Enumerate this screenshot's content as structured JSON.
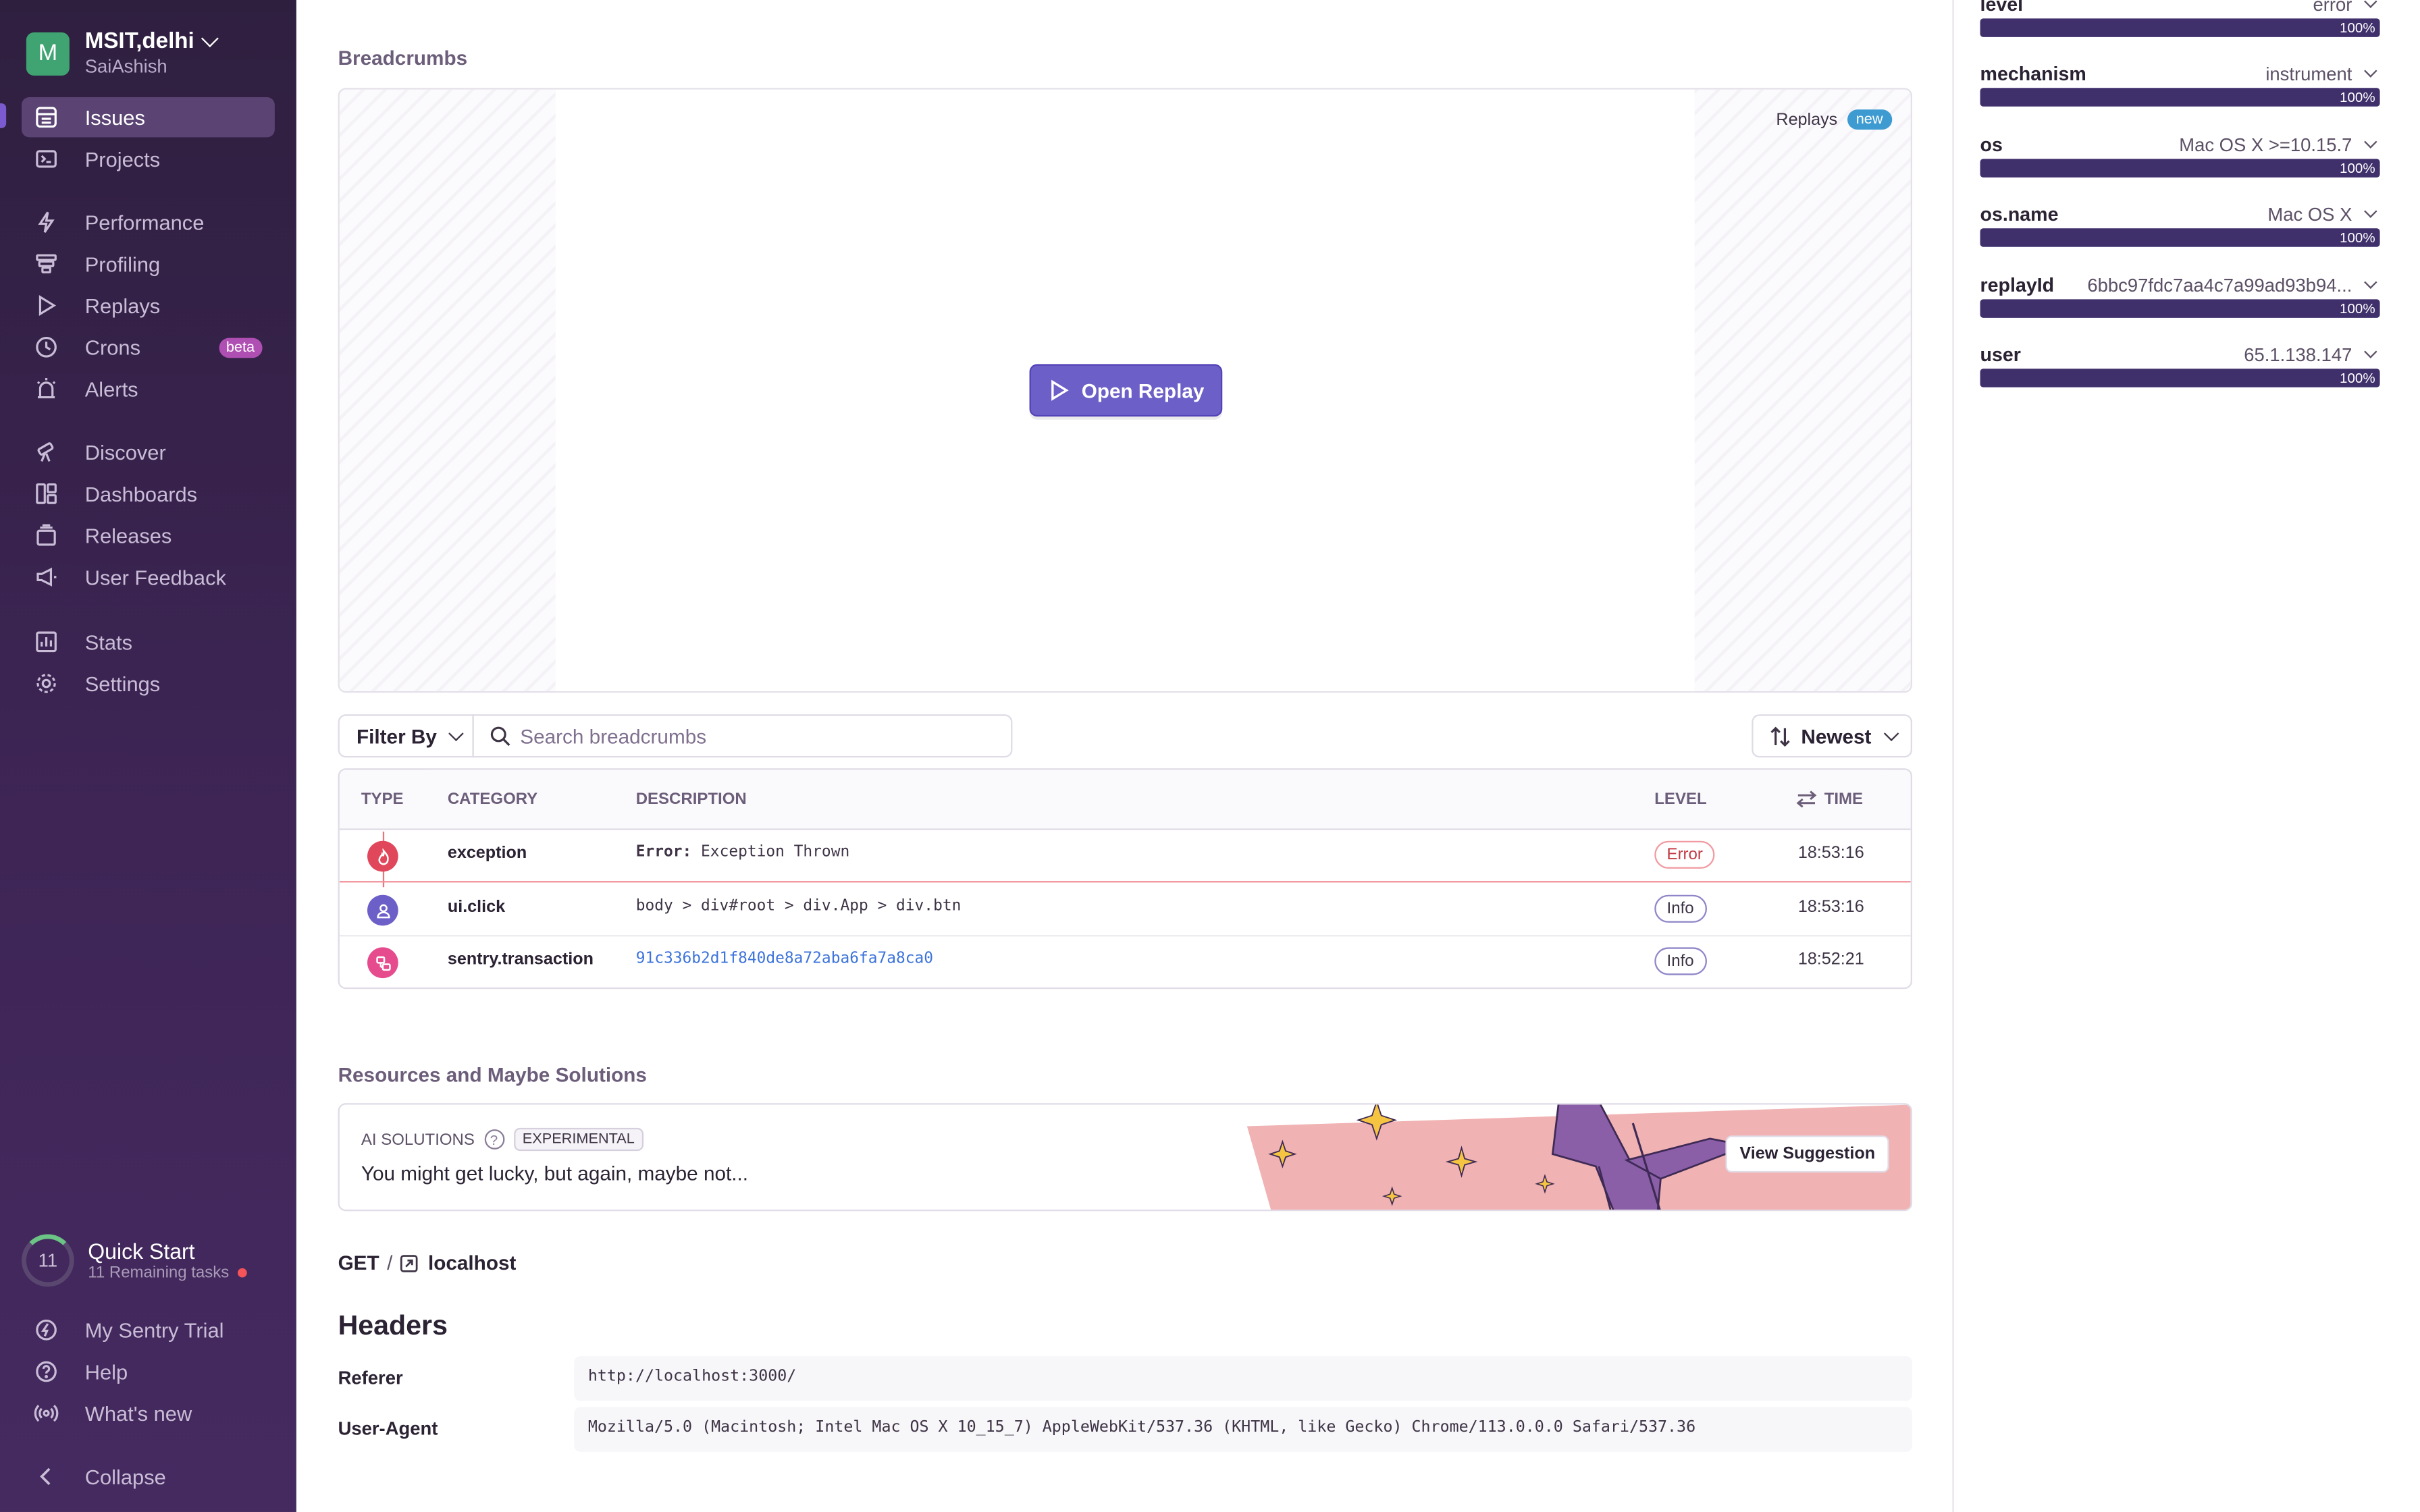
{
  "org": {
    "initial": "M",
    "name": "MSIT,delhi",
    "user": "SaiAshish"
  },
  "nav": {
    "issues": "Issues",
    "projects": "Projects",
    "performance": "Performance",
    "profiling": "Profiling",
    "replays": "Replays",
    "crons": "Crons",
    "crons_badge": "beta",
    "alerts": "Alerts",
    "discover": "Discover",
    "dashboards": "Dashboards",
    "releases": "Releases",
    "user_feedback": "User Feedback",
    "stats": "Stats",
    "settings": "Settings"
  },
  "quick_start": {
    "count": "11",
    "title": "Quick Start",
    "subtitle": "11 Remaining tasks"
  },
  "footer_nav": {
    "trial": "My Sentry Trial",
    "help": "Help",
    "whats_new": "What's new",
    "collapse": "Collapse"
  },
  "breadcrumbs": {
    "title": "Breadcrumbs",
    "replays_label": "Replays",
    "new_badge": "new",
    "open_replay": "Open Replay",
    "filter_by": "Filter By",
    "search_placeholder": "Search breadcrumbs",
    "sort": "Newest",
    "columns": {
      "type": "TYPE",
      "category": "CATEGORY",
      "description": "DESCRIPTION",
      "level": "LEVEL",
      "time": "TIME"
    },
    "rows": [
      {
        "category": "exception",
        "description_prefix": "Error:",
        "description": " Exception Thrown",
        "level": "Error",
        "time": "18:53:16",
        "icon": "fire-icon",
        "color": "#e0475b"
      },
      {
        "category": "ui.click",
        "description": "body > div#root > div.App > div.btn",
        "level": "Info",
        "time": "18:53:16",
        "icon": "user-icon",
        "color": "#6c5fc7"
      },
      {
        "category": "sentry.transaction",
        "description": "91c336b2d1f840de8a72aba6fa7a8ca0",
        "level": "Info",
        "time": "18:52:21",
        "icon": "transaction-icon",
        "color": "#e54b8d"
      }
    ]
  },
  "resources": {
    "title": "Resources and Maybe Solutions",
    "ai_label": "AI SOLUTIONS",
    "help_glyph": "?",
    "badge": "EXPERIMENTAL",
    "message": "You might get lucky, but again, maybe not...",
    "button": "View Suggestion"
  },
  "request": {
    "method": "GET",
    "separator": "/",
    "host": "localhost"
  },
  "headers": {
    "title": "Headers",
    "items": [
      {
        "key": "Referer",
        "value": "http://localhost:3000/"
      },
      {
        "key": "User-Agent",
        "value": "Mozilla/5.0 (Macintosh; Intel Mac OS X 10_15_7) AppleWebKit/537.36 (KHTML, like Gecko) Chrome/113.0.0.0 Safari/537.36"
      }
    ]
  },
  "tags": [
    {
      "key": "level",
      "value": "error",
      "percent": "100%"
    },
    {
      "key": "mechanism",
      "value": "instrument",
      "percent": "100%"
    },
    {
      "key": "os",
      "value": "Mac OS X >=10.15.7",
      "percent": "100%"
    },
    {
      "key": "os.name",
      "value": "Mac OS X",
      "percent": "100%"
    },
    {
      "key": "replayId",
      "value": "6bbc97fdc7aa4c7a99ad93b94...",
      "percent": "100%"
    },
    {
      "key": "user",
      "value": "65.1.138.147",
      "percent": "100%"
    }
  ],
  "colors": {
    "accent": "#6c5fc7",
    "sidebar": "#3e2556",
    "error": "#e0475b",
    "tag_bar": "#3f2f6b"
  }
}
